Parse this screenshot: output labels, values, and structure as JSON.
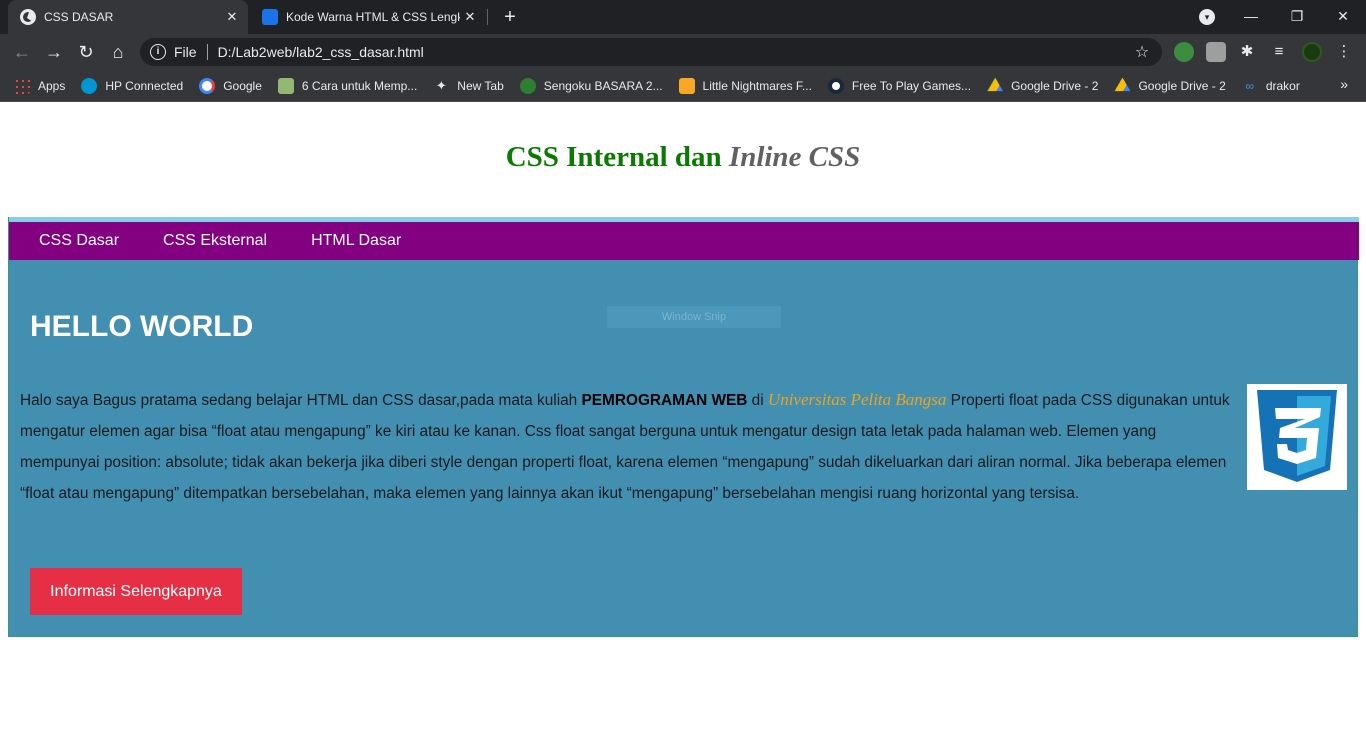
{
  "browser": {
    "tabs": [
      {
        "title": "CSS DASAR",
        "close": "✕"
      },
      {
        "title": "Kode Warna HTML & CSS Lengkap",
        "close": "✕"
      }
    ],
    "new_tab": "+",
    "omnibox": {
      "scheme": "File",
      "url": "D:/Lab2web/lab2_css_dasar.html"
    },
    "bookmarks": [
      {
        "label": "Apps",
        "icon": "apps-grid-icon",
        "color": "#e8453c"
      },
      {
        "label": "HP Connected",
        "icon": "hp-icon",
        "color": "#0096d6"
      },
      {
        "label": "Google",
        "icon": "google-icon",
        "color": "#ffffff"
      },
      {
        "label": "6 Cara untuk Memp...",
        "icon": "wikihow-icon",
        "color": "#93b874"
      },
      {
        "label": "New Tab",
        "icon": "new-tab-icon",
        "color": "#e8eaed"
      },
      {
        "label": "Sengoku BASARA 2...",
        "icon": "game-icon",
        "color": "#2e7d32"
      },
      {
        "label": "Little Nightmares F...",
        "icon": "folder-icon",
        "color": "#f9a825"
      },
      {
        "label": "Free To Play Games...",
        "icon": "steam-icon",
        "color": "#ffffff"
      },
      {
        "label": "Google Drive - 2",
        "icon": "google-drive-icon",
        "color": "#34a853"
      },
      {
        "label": "Google Drive - 2",
        "icon": "google-drive-icon",
        "color": "#fbbc04"
      },
      {
        "label": "drakor",
        "icon": "link-icon",
        "color": "#4a90e2"
      }
    ],
    "more_bookmarks": "»"
  },
  "page": {
    "title_part1": "CSS Internal dan ",
    "title_part2": "Inline CSS",
    "nav": [
      "CSS Dasar",
      "CSS Eksternal",
      "HTML Dasar"
    ],
    "heading": "HELLO WORLD",
    "overlay": "Window Snip",
    "paragraph": {
      "before_bold": "Halo saya Bagus pratama sedang belajar HTML dan CSS dasar,pada mata kuliah ",
      "bold": "PEMROGRAMAN WEB",
      "middle": " di ",
      "university": "Universitas Pelita Bangsa",
      "after": " Properti float pada CSS digunakan untuk mengatur elemen agar bisa “float atau mengapung” ke kiri atau ke kanan. Css float sangat berguna untuk mengatur design tata letak pada halaman web. Elemen yang mempunyai position: absolute; tidak akan bekerja jika diberi style dengan properti float, karena elemen “mengapung” sudah dikeluarkan dari aliran normal. Jika beberapa elemen “float atau mengapung” ditempatkan bersebelahan, maka elemen yang lainnya akan ikut “mengapung” bersebelahan mengisi ruang horizontal yang tersisa."
    },
    "button": "Informasi Selengkapnya",
    "logo_icon": "css3-logo-icon"
  },
  "colors": {
    "title_green": "#0a7a00",
    "nav_purple": "#830080",
    "content_blue": "#428fb2",
    "button_red": "#e62e45",
    "university_orange": "#f0a41a"
  }
}
